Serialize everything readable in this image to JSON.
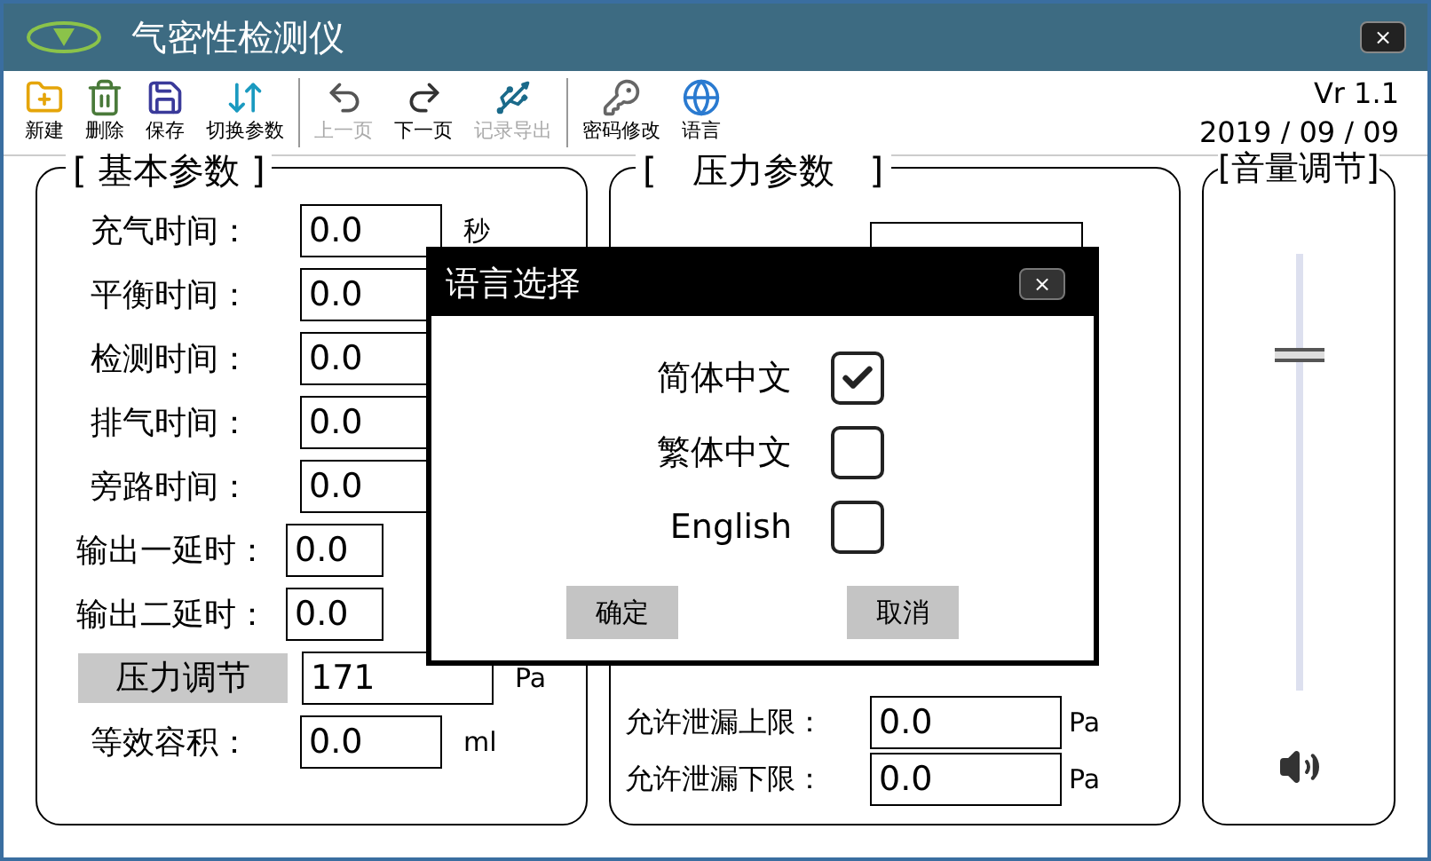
{
  "window": {
    "title": "气密性检测仪",
    "close": "×"
  },
  "toolbar": {
    "groups": [
      [
        {
          "label": "新建",
          "disabled": false
        },
        {
          "label": "删除",
          "disabled": false
        },
        {
          "label": "保存",
          "disabled": false
        },
        {
          "label": "切换参数",
          "disabled": false
        }
      ],
      [
        {
          "label": "上一页",
          "disabled": true
        },
        {
          "label": "下一页",
          "disabled": false
        },
        {
          "label": "记录导出",
          "disabled": true
        }
      ],
      [
        {
          "label": "密码修改",
          "disabled": false
        },
        {
          "label": "语言",
          "disabled": false
        }
      ]
    ],
    "version": "Vr 1.1",
    "date": "2019 / 09 / 09"
  },
  "basic": {
    "title": "[ 基本参数 ]",
    "rows": [
      {
        "kind": "field",
        "label": "充气时间：",
        "value": "0.0",
        "unit": "秒"
      },
      {
        "kind": "field",
        "label": "平衡时间：",
        "value": "0.0"
      },
      {
        "kind": "field",
        "label": "检测时间：",
        "value": "0.0"
      },
      {
        "kind": "field",
        "label": "排气时间：",
        "value": "0.0"
      },
      {
        "kind": "field",
        "label": "旁路时间：",
        "value": "0.0"
      },
      {
        "kind": "short",
        "label": "输出一延时：",
        "value": "0.0"
      },
      {
        "kind": "short",
        "label": "输出二延时：",
        "value": "0.0"
      },
      {
        "kind": "button",
        "label": "压力调节",
        "value": "171",
        "unit": "Pa"
      },
      {
        "kind": "field",
        "label": "等效容积：",
        "value": "0.0",
        "unit": "ml"
      }
    ]
  },
  "pressure": {
    "title": "[　压力参数　]",
    "rows": [
      {
        "label": "允许泄漏上限：",
        "value": "0.0",
        "unit": "Pa"
      },
      {
        "label": "允许泄漏下限：",
        "value": "0.0",
        "unit": "Pa"
      }
    ]
  },
  "volume": {
    "title": "[音量调节]",
    "level": 0.77
  },
  "dialog": {
    "title": "语言选择",
    "close": "×",
    "options": [
      {
        "label": "简体中文",
        "checked": true
      },
      {
        "label": "繁体中文",
        "checked": false
      },
      {
        "label": "English",
        "checked": false
      }
    ],
    "buttons": [
      "确定",
      "取消"
    ]
  }
}
